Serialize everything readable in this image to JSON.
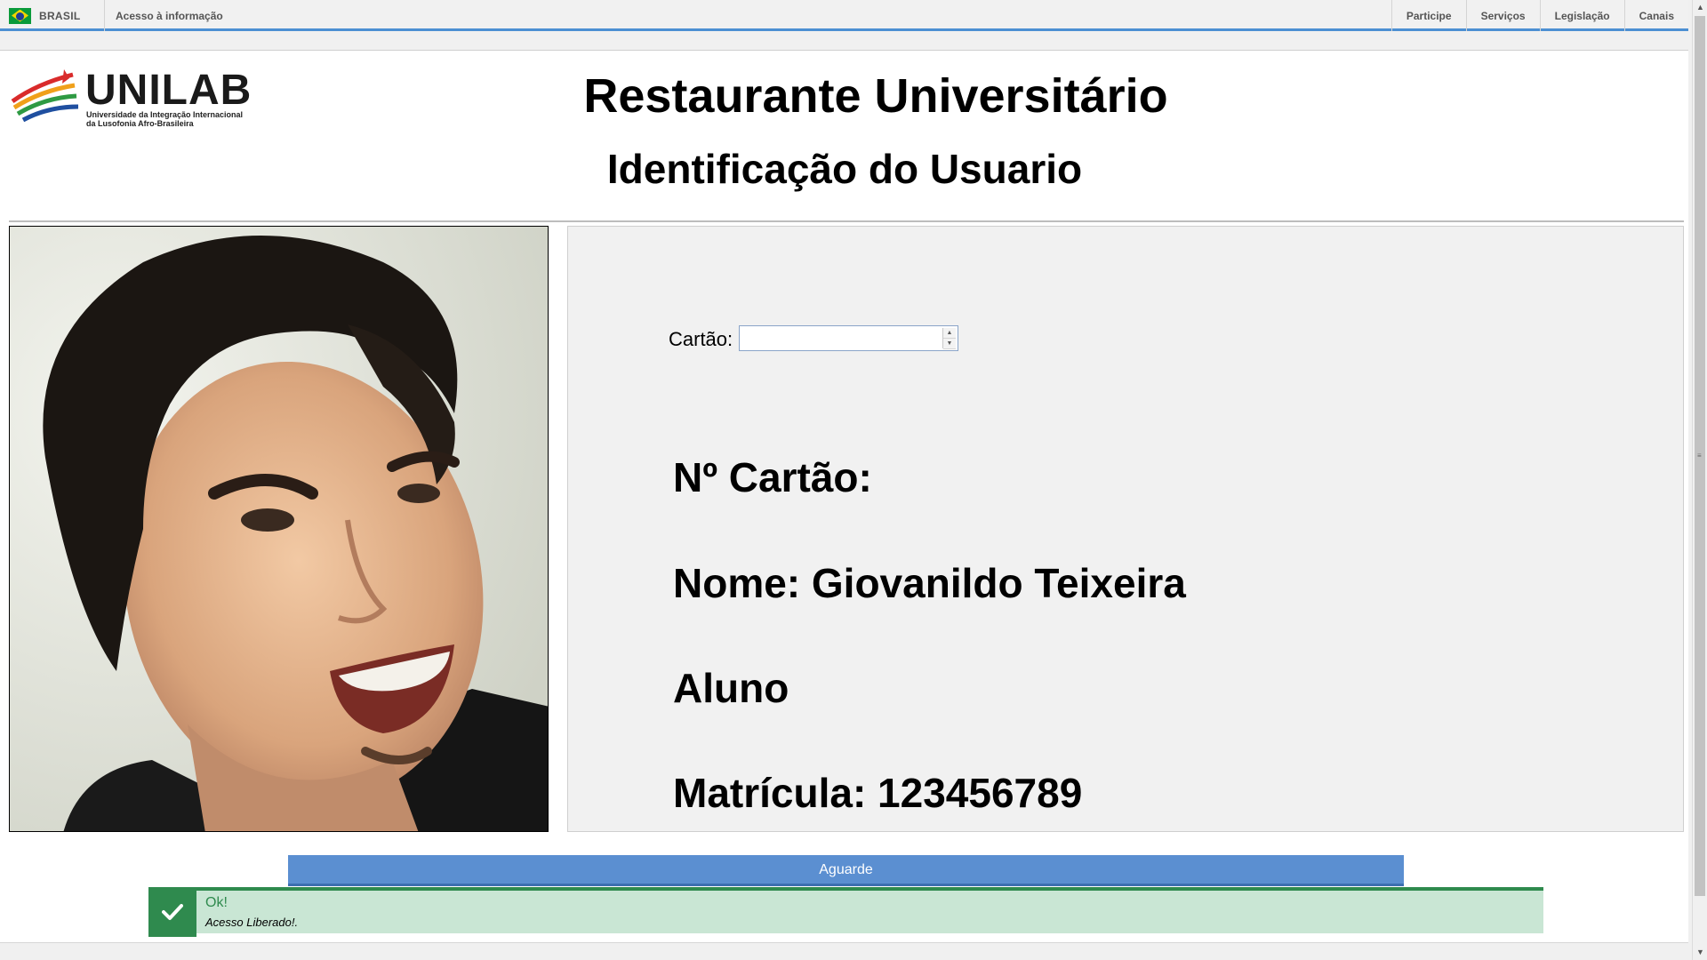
{
  "govbar": {
    "brasil_label": "BRASIL",
    "acesso_label": "Acesso à informação",
    "links": [
      "Participe",
      "Serviços",
      "Legislação",
      "Canais"
    ]
  },
  "header": {
    "logo_text": "UNILAB",
    "logo_sub_line1": "Universidade da Integração Internacional",
    "logo_sub_line2": "da Lusofonia Afro-Brasileira",
    "title": "Restaurante Universitário",
    "subtitle": "Identificação do Usuario"
  },
  "form": {
    "cartao_label": "Cartão:",
    "cartao_value": ""
  },
  "user": {
    "numero_cartao": "Nº Cartão:",
    "nome": "Nome: Giovanildo Teixeira",
    "tipo": "Aluno",
    "matricula": "Matrícula: 123456789"
  },
  "button": {
    "aguarde_label": "Aguarde"
  },
  "alert": {
    "title": "Ok!",
    "message": "Acesso Liberado!.",
    "color": "#2f8a4e"
  },
  "colors": {
    "accent_blue": "#4c8fd3",
    "button_blue": "#5b8fd1"
  }
}
